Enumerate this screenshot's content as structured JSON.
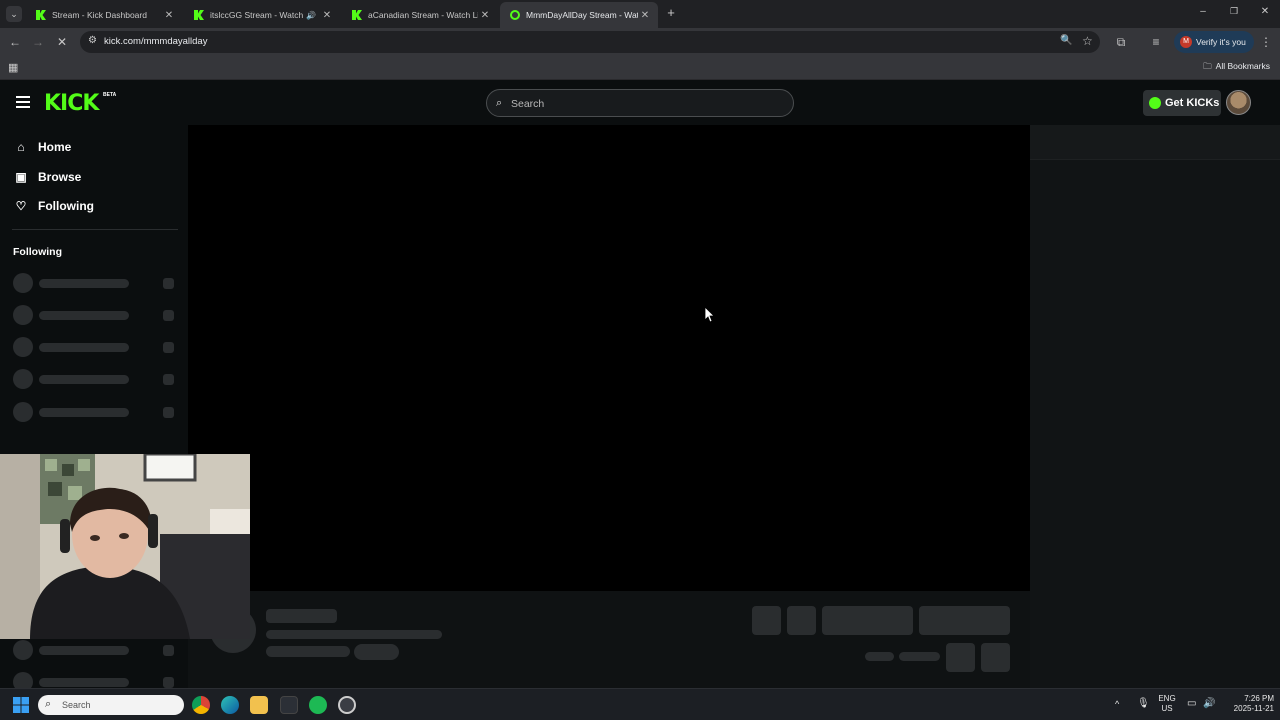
{
  "browser": {
    "tabs": [
      {
        "title": "Stream - Kick Dashboard",
        "active": false
      },
      {
        "title": "itslccGG Stream - Watch Live",
        "active": false,
        "audio": true
      },
      {
        "title": "aCanadian Stream - Watch Live",
        "active": false
      },
      {
        "title": "MmmDayAllDay Stream - Watch",
        "active": true
      }
    ],
    "close_glyph": "✕",
    "new_tab_glyph": "+",
    "url": "kick.com/mmmdayallday",
    "verify_label": "Verify it's you",
    "verify_initial": "M",
    "bookmarks_label": "All Bookmarks",
    "window_controls": {
      "minimize": "–",
      "maximize": "❐",
      "close": "✕"
    }
  },
  "kick": {
    "logo": "KICK",
    "logo_badge": "BETA",
    "search_placeholder": "Search",
    "get_kicks_label": "Get KICKs",
    "nav": [
      {
        "label": "Home",
        "icon": "home-icon"
      },
      {
        "label": "Browse",
        "icon": "browse-icon"
      },
      {
        "label": "Following",
        "icon": "heart-icon"
      }
    ],
    "following_header": "Following",
    "skeleton_rows": 5,
    "brand_color": "#53fc18"
  },
  "taskbar": {
    "search_placeholder": "Search",
    "lang_top": "ENG",
    "lang_bottom": "US",
    "time": "7:26 PM",
    "date": "2025-11-21"
  }
}
